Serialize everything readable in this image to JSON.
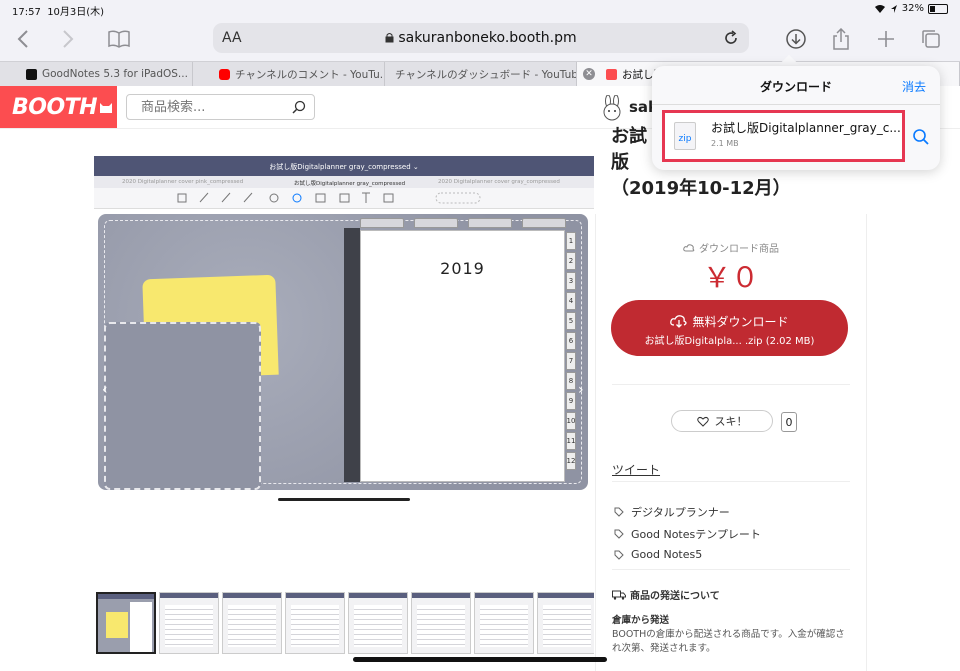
{
  "status_bar": {
    "time": "17:57",
    "date": "10月3日(木)",
    "battery": "32%"
  },
  "toolbar": {
    "aa_label": "AA",
    "url": "sakuranboneko.booth.pm"
  },
  "tabs": [
    {
      "label": "GoodNotes 5.3 for iPadOS...",
      "favicon_color": "#111111"
    },
    {
      "label": "チャンネルのコメント - YouTu...",
      "favicon_color": "#ff0000"
    },
    {
      "label": "チャンネルのダッシュボード - YouTub...",
      "favicon_color": ""
    },
    {
      "label": "お試し版",
      "favicon_color": "#fc4d50"
    }
  ],
  "booth": {
    "logo": "BOOTH",
    "search_placeholder": "商品検索...",
    "shop_name": "sak",
    "brand_color": "#fc4d50"
  },
  "product": {
    "title_lines": [
      "お試",
      "版",
      "（2019年10-12月）"
    ],
    "download_label": "ダウンロード商品",
    "price": "￥０",
    "download_button": "無料ダウンロード",
    "download_button_sub": "お試し版Digitalpla... .zip (2.02 MB)",
    "like_label": "スキ！",
    "like_count": "0",
    "tweet_label": "ツイート",
    "tags": [
      "デジタルプランナー",
      "Good Notesテンプレート",
      "Good Notes5"
    ],
    "shipping_heading": "商品の発送について",
    "shipping_sub": "倉庫から発送",
    "shipping_text": "BOOTHの倉庫から配送される商品です。入金が確認され次第、発送されます。"
  },
  "preview": {
    "app_title": "お試し版Digitalplanner gray_compressed ⌄",
    "tab_left": "2020 Digitalplanner cover pink_compressed",
    "tab_center": "お試し版Digitalplanner gray_compressed",
    "tab_right": "2020 Digitalplanner cover gray_compressed",
    "year": "2019",
    "months": [
      "1",
      "2",
      "3",
      "4",
      "5",
      "6",
      "7",
      "8",
      "9",
      "10",
      "11",
      "12"
    ]
  },
  "download_popover": {
    "title": "ダウンロード",
    "clear_label": "消去",
    "file_name": "お試し版Digitalplanner_gray_c...",
    "file_size": "2.1 MB",
    "file_type": "zip",
    "highlight_color": "#e63752"
  }
}
